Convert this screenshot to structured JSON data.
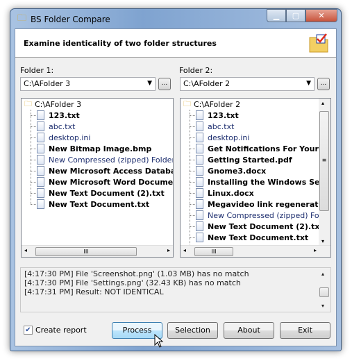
{
  "window": {
    "title": "BS Folder Compare",
    "minimize": "▁",
    "maximize": "▢",
    "close": "✕"
  },
  "header": {
    "text": "Examine identicality of two folder structures"
  },
  "folder1": {
    "label": "Folder 1:",
    "value": "C:\\AFolder 3",
    "browse": "...",
    "root": "C:\\AFolder 3",
    "files": [
      {
        "name": "123.txt",
        "bold": true
      },
      {
        "name": "abc.txt",
        "bold": false
      },
      {
        "name": "desktop.ini",
        "bold": false
      },
      {
        "name": "New Bitmap Image.bmp",
        "bold": true
      },
      {
        "name": "New Compressed (zipped) Folder.zip",
        "bold": false
      },
      {
        "name": "New Microsoft Access Database",
        "bold": true
      },
      {
        "name": "New Microsoft Word Document",
        "bold": true
      },
      {
        "name": "New Text Document (2).txt",
        "bold": true
      },
      {
        "name": "New Text Document.txt",
        "bold": true
      }
    ]
  },
  "folder2": {
    "label": "Folder 2:",
    "value": "C:\\AFolder 2",
    "browse": "...",
    "root": "C:\\AFolder 2",
    "files": [
      {
        "name": "123.txt",
        "bold": true
      },
      {
        "name": "abc.txt",
        "bold": false
      },
      {
        "name": "desktop.ini",
        "bold": false
      },
      {
        "name": "Get Notifications For Your Gmail",
        "bold": true
      },
      {
        "name": "Getting Started.pdf",
        "bold": true
      },
      {
        "name": "Gnome3.docx",
        "bold": true
      },
      {
        "name": "Installing the Windows Server",
        "bold": true
      },
      {
        "name": "Linux.docx",
        "bold": true
      },
      {
        "name": "Megavideo link regenerator",
        "bold": true
      },
      {
        "name": "New Compressed (zipped) Folder",
        "bold": false
      },
      {
        "name": "New Text Document (2).txt",
        "bold": true
      },
      {
        "name": "New Text Document.txt",
        "bold": true
      }
    ]
  },
  "log": [
    "[4:17:30 PM] File 'Screenshot.png' (1.03 MB) has no match",
    "[4:17:30 PM] File 'Settings.png' (32.43 KB) has no match",
    "[4:17:31 PM] Result: NOT IDENTICAL"
  ],
  "footer": {
    "create_report": "Create report",
    "create_report_checked": true,
    "process": "Process",
    "selection": "Selection",
    "about": "About",
    "exit": "Exit"
  }
}
